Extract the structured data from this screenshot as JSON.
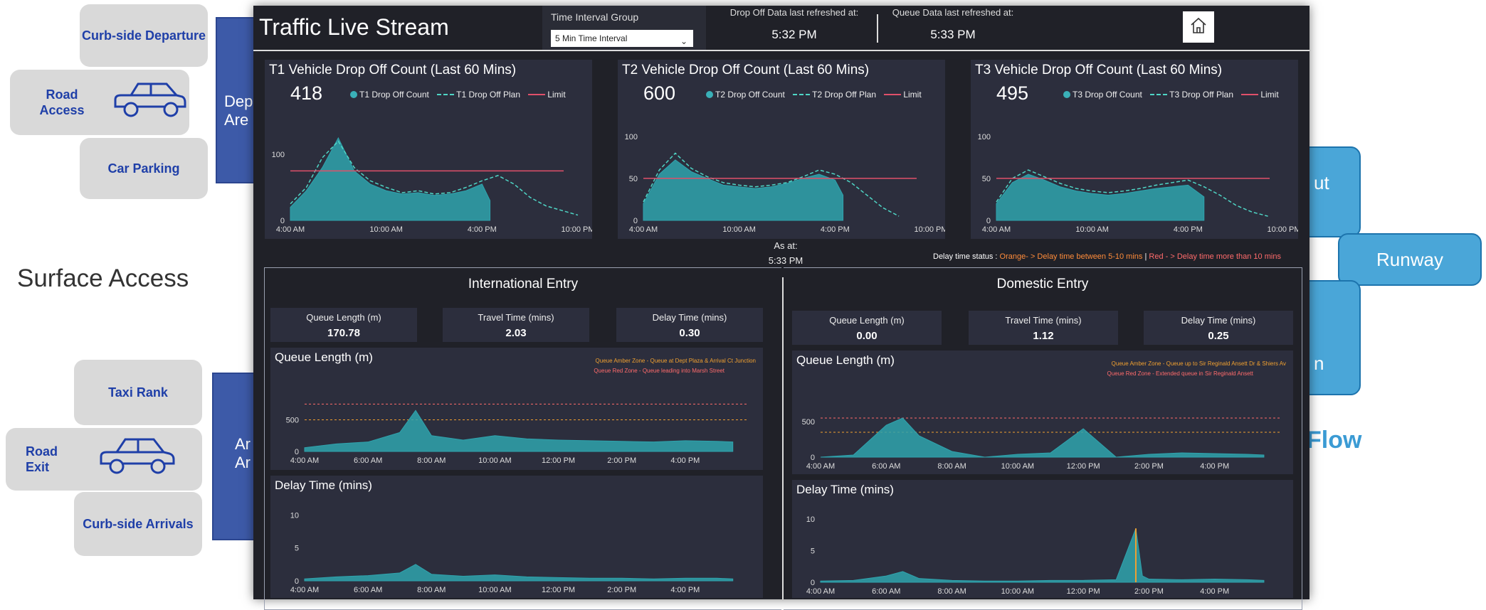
{
  "background": {
    "tickets_top": [
      "Curb-side Departure",
      "Road Access",
      "Car Parking"
    ],
    "tickets_bottom": [
      "Taxi Rank",
      "Road Exit",
      "Curb-side Arrivals"
    ],
    "surface_access": "Surface Access",
    "dep_box": "Dep Are",
    "arr_box": "Ar Ar",
    "runway": "Runway",
    "right_top": "ut",
    "right_bottom": "n",
    "flow": "Flow"
  },
  "dashboard": {
    "title": "Traffic Live Stream",
    "interval_group": {
      "label": "Time Interval Group",
      "selected": "5 Min Time Interval"
    },
    "dropoff_refresh": {
      "label": "Drop Off Data last refreshed at:",
      "value": "5:32 PM"
    },
    "queue_refresh": {
      "label": "Queue Data last refreshed at:",
      "value": "5:33 PM"
    },
    "as_at": {
      "label": "As at:",
      "value": "5:33 PM"
    },
    "delay_status": {
      "label": "Delay time status : ",
      "orange": "Orange- > Delay time between 5-10 mins",
      "sep": " | ",
      "red": "Red - > Delay time more than 10 mins"
    },
    "terminals": [
      {
        "title": "T1 Vehicle Drop Off Count (Last 60 Mins)",
        "count": "418",
        "legend_count": "T1 Drop Off Count",
        "legend_plan": "T1 Drop Off Plan",
        "legend_limit": "Limit"
      },
      {
        "title": "T2 Vehicle Drop Off Count (Last 60 Mins)",
        "count": "600",
        "legend_count": "T2 Drop Off Count",
        "legend_plan": "T2 Drop Off Plan",
        "legend_limit": "Limit"
      },
      {
        "title": "T3 Vehicle Drop Off Count (Last 60 Mins)",
        "count": "495",
        "legend_count": "T3 Drop Off Count",
        "legend_plan": "T3 Drop Off Plan",
        "legend_limit": "Limit"
      }
    ],
    "entries": [
      {
        "title": "International Entry",
        "cards": [
          {
            "label": "Queue Length (m)",
            "value": "170.78"
          },
          {
            "label": "Travel Time (mins)",
            "value": "2.03"
          },
          {
            "label": "Delay Time (mins)",
            "value": "0.30"
          }
        ],
        "queue_chart_title": "Queue Length (m)",
        "amber_zone": "Queue Amber Zone - Queue at Dept Plaza & Arrival Ct Junction",
        "red_zone": "Queue Red Zone - Queue leading into Marsh Street",
        "delay_chart_title": "Delay Time (mins)"
      },
      {
        "title": "Domestic Entry",
        "cards": [
          {
            "label": "Queue Length (m)",
            "value": "0.00"
          },
          {
            "label": "Travel Time (mins)",
            "value": "1.12"
          },
          {
            "label": "Delay Time (mins)",
            "value": "0.25"
          }
        ],
        "queue_chart_title": "Queue Length (m)",
        "amber_zone": "Queue Amber Zone - Queue up to Sir Reginald Ansett Dr & Shiers Av",
        "red_zone": "Queue Red Zone - Extended queue in Sir Reginald Ansett",
        "delay_chart_title": "Delay Time (mins)"
      }
    ],
    "colors": {
      "bg": "#202128",
      "panel": "#2c2e3d",
      "teal": "#2fa3ad",
      "plan": "#4fd6c6",
      "limit": "#e0506a",
      "amber": "#f0a030",
      "red": "#ff6b6b",
      "orange_status": "#ff8c3a",
      "red_status": "#ff6b6b"
    }
  },
  "chart_data": [
    {
      "type": "area",
      "title": "T1 Vehicle Drop Off Count (Last 60 Mins)",
      "x_ticks": [
        "4:00 AM",
        "10:00 AM",
        "4:00 PM",
        "10:00 PM"
      ],
      "y_ticks": [
        0,
        100
      ],
      "ylim": [
        0,
        140
      ],
      "limit": 75,
      "series": [
        {
          "name": "T1 Drop Off Count",
          "x": [
            4,
            5,
            6,
            7,
            8,
            9,
            10,
            11,
            12,
            13,
            14,
            15,
            16,
            16.5
          ],
          "values": [
            20,
            45,
            80,
            125,
            75,
            55,
            45,
            40,
            42,
            38,
            40,
            45,
            55,
            30
          ]
        },
        {
          "name": "T1 Drop Off Plan",
          "x": [
            4,
            5,
            6,
            7,
            8,
            9,
            10,
            11,
            12,
            13,
            14,
            15,
            16,
            17,
            18,
            19,
            20,
            21,
            22
          ],
          "values": [
            25,
            50,
            95,
            120,
            80,
            60,
            50,
            42,
            45,
            40,
            42,
            50,
            60,
            68,
            55,
            35,
            22,
            15,
            8
          ]
        }
      ]
    },
    {
      "type": "area",
      "title": "T2 Vehicle Drop Off Count (Last 60 Mins)",
      "x_ticks": [
        "4:00 AM",
        "10:00 AM",
        "4:00 PM",
        "10:00 PM"
      ],
      "y_ticks": [
        0,
        50,
        100
      ],
      "ylim": [
        0,
        110
      ],
      "limit": 50,
      "series": [
        {
          "name": "T2 Drop Off Count",
          "x": [
            4,
            5,
            6,
            7,
            8,
            9,
            10,
            11,
            12,
            13,
            14,
            15,
            16,
            16.5
          ],
          "values": [
            20,
            55,
            72,
            58,
            50,
            42,
            40,
            38,
            40,
            44,
            50,
            55,
            48,
            30
          ]
        },
        {
          "name": "T2 Drop Off Plan",
          "x": [
            4,
            5,
            6,
            7,
            8,
            9,
            10,
            11,
            12,
            13,
            14,
            15,
            16,
            17,
            18,
            19,
            20
          ],
          "values": [
            22,
            60,
            80,
            62,
            52,
            45,
            42,
            40,
            42,
            45,
            52,
            60,
            55,
            45,
            30,
            15,
            5
          ]
        }
      ]
    },
    {
      "type": "area",
      "title": "T3 Vehicle Drop Off Count (Last 60 Mins)",
      "x_ticks": [
        "4:00 AM",
        "10:00 AM",
        "4:00 PM",
        "10:00 PM"
      ],
      "y_ticks": [
        0,
        50,
        100
      ],
      "ylim": [
        0,
        110
      ],
      "limit": 50,
      "series": [
        {
          "name": "T3 Drop Off Count",
          "x": [
            4,
            5,
            6,
            7,
            8,
            9,
            10,
            11,
            12,
            13,
            14,
            15,
            16,
            17
          ],
          "values": [
            20,
            45,
            55,
            48,
            40,
            35,
            32,
            30,
            32,
            35,
            38,
            40,
            42,
            28
          ]
        },
        {
          "name": "T3 Drop Off Plan",
          "x": [
            4,
            5,
            6,
            7,
            8,
            9,
            10,
            11,
            12,
            13,
            14,
            15,
            16,
            17,
            18,
            19,
            20,
            21
          ],
          "values": [
            22,
            50,
            60,
            52,
            44,
            38,
            35,
            33,
            35,
            38,
            42,
            45,
            48,
            40,
            30,
            18,
            10,
            5
          ]
        }
      ]
    },
    {
      "type": "area",
      "title": "Queue Length (m)",
      "x_ticks": [
        "4:00 AM",
        "6:00 AM",
        "8:00 AM",
        "10:00 AM",
        "12:00 PM",
        "2:00 PM",
        "4:00 PM"
      ],
      "y_ticks": [
        0,
        500
      ],
      "ylim": [
        0,
        900
      ],
      "series": [
        {
          "x": [
            4,
            5,
            6,
            7,
            7.5,
            8,
            9,
            10,
            11,
            12,
            13,
            14,
            15,
            16,
            17,
            17.5
          ],
          "values": [
            60,
            120,
            150,
            300,
            650,
            250,
            180,
            250,
            200,
            180,
            170,
            160,
            150,
            170,
            160,
            150
          ]
        }
      ]
    },
    {
      "type": "area",
      "title": "Delay Time (mins)",
      "x_ticks": [
        "4:00 AM",
        "6:00 AM",
        "8:00 AM",
        "10:00 AM",
        "12:00 PM",
        "2:00 PM",
        "4:00 PM"
      ],
      "y_ticks": [
        0,
        5,
        10
      ],
      "ylim": [
        0,
        11
      ],
      "series": [
        {
          "x": [
            4,
            5,
            6,
            7,
            7.5,
            8,
            9,
            10,
            11,
            12,
            13,
            14,
            15,
            16,
            17,
            17.5
          ],
          "values": [
            0.3,
            0.6,
            0.8,
            1.2,
            2.5,
            1.0,
            0.7,
            0.9,
            0.6,
            0.5,
            0.4,
            0.4,
            0.3,
            0.4,
            0.4,
            0.3
          ]
        }
      ]
    },
    {
      "type": "area",
      "title": "Queue Length (m)",
      "x_ticks": [
        "4:00 AM",
        "6:00 AM",
        "8:00 AM",
        "10:00 AM",
        "12:00 PM",
        "2:00 PM",
        "4:00 PM"
      ],
      "y_ticks": [
        0,
        500
      ],
      "ylim": [
        0,
        800
      ],
      "series": [
        {
          "x": [
            4,
            5,
            6,
            6.5,
            7,
            8,
            9,
            10,
            11,
            12,
            13,
            14,
            15,
            16,
            17,
            17.5
          ],
          "values": [
            0,
            30,
            450,
            550,
            300,
            80,
            0,
            40,
            60,
            400,
            0,
            40,
            60,
            50,
            40,
            30
          ]
        }
      ]
    },
    {
      "type": "area",
      "title": "Delay Time (mins)",
      "x_ticks": [
        "4:00 AM",
        "6:00 AM",
        "8:00 AM",
        "10:00 AM",
        "12:00 PM",
        "2:00 PM",
        "4:00 PM"
      ],
      "y_ticks": [
        0,
        5,
        10
      ],
      "ylim": [
        0,
        11
      ],
      "series": [
        {
          "x": [
            4,
            5,
            6,
            6.5,
            7,
            8,
            9,
            10,
            11,
            12,
            13,
            13.6,
            13.8,
            14,
            15,
            16,
            17,
            17.5
          ],
          "values": [
            0.2,
            0.3,
            1.0,
            1.7,
            0.6,
            0.3,
            0.2,
            0.2,
            0.3,
            0.3,
            0.4,
            8.5,
            1.0,
            0.5,
            0.4,
            0.5,
            0.4,
            0.3
          ]
        }
      ]
    }
  ]
}
